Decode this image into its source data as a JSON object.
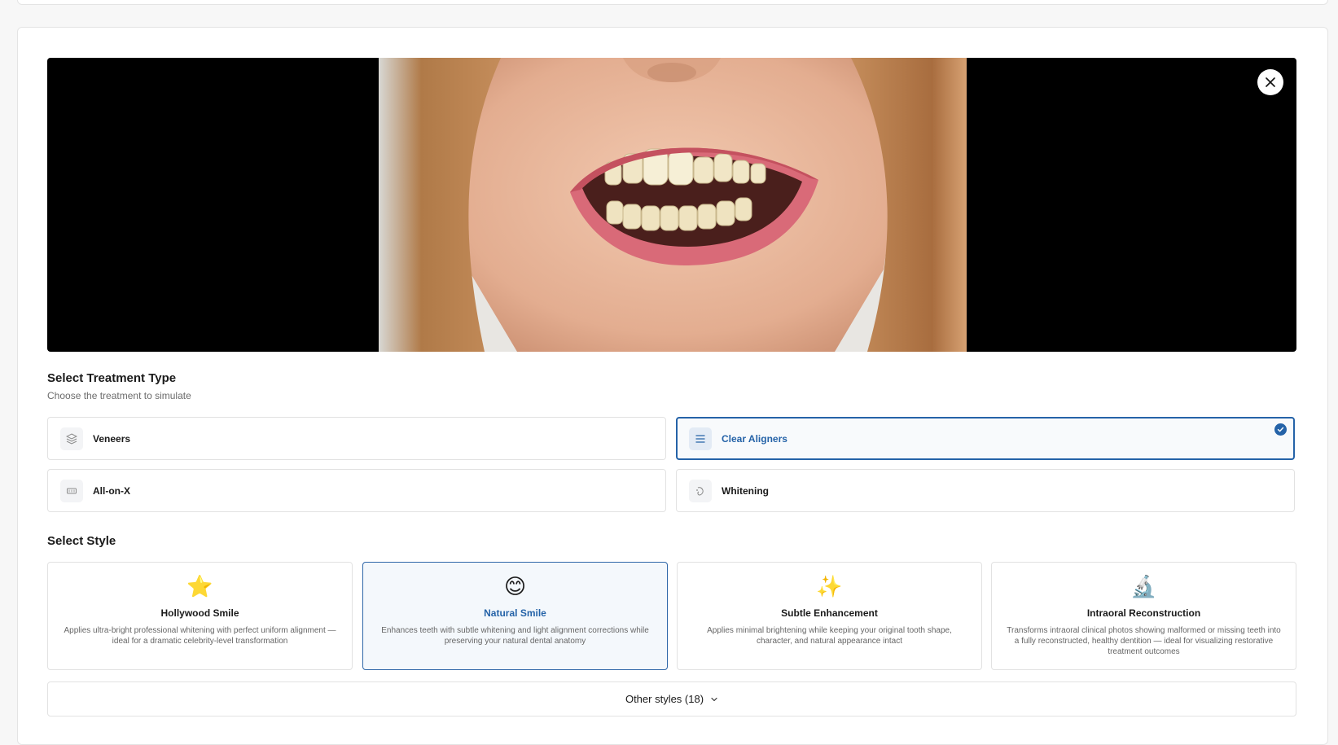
{
  "treatment_section": {
    "title": "Select Treatment Type",
    "subtitle": "Choose the treatment to simulate",
    "options": [
      {
        "label": "Veneers",
        "icon": "layers-icon",
        "selected": false
      },
      {
        "label": "Clear Aligners",
        "icon": "menu-lines-icon",
        "selected": true
      },
      {
        "label": "All-on-X",
        "icon": "implant-bar-icon",
        "selected": false
      },
      {
        "label": "Whitening",
        "icon": "sparkle-tooth-icon",
        "selected": false
      }
    ]
  },
  "style_section": {
    "title": "Select Style",
    "styles": [
      {
        "emoji": "⭐",
        "name": "Hollywood Smile",
        "description": "Applies ultra-bright professional whitening with perfect uniform alignment — ideal for a dramatic celebrity-level transformation",
        "selected": false
      },
      {
        "emoji": "😊",
        "name": "Natural Smile",
        "description": "Enhances teeth with subtle whitening and light alignment corrections while preserving your natural dental anatomy",
        "selected": true
      },
      {
        "emoji": "✨",
        "name": "Subtle Enhancement",
        "description": "Applies minimal brightening while keeping your original tooth shape, character, and natural appearance intact",
        "selected": false
      },
      {
        "emoji": "🔬",
        "name": "Intraoral Reconstruction",
        "description": "Transforms intraoral clinical photos showing malformed or missing teeth into a fully reconstructed, healthy dentition — ideal for visualizing restorative treatment outcomes",
        "selected": false
      }
    ],
    "other_styles_label": "Other styles (18)"
  },
  "colors": {
    "accent": "#2563a8",
    "selected_bg": "#f4f8fc",
    "border": "#e2e2e2"
  }
}
